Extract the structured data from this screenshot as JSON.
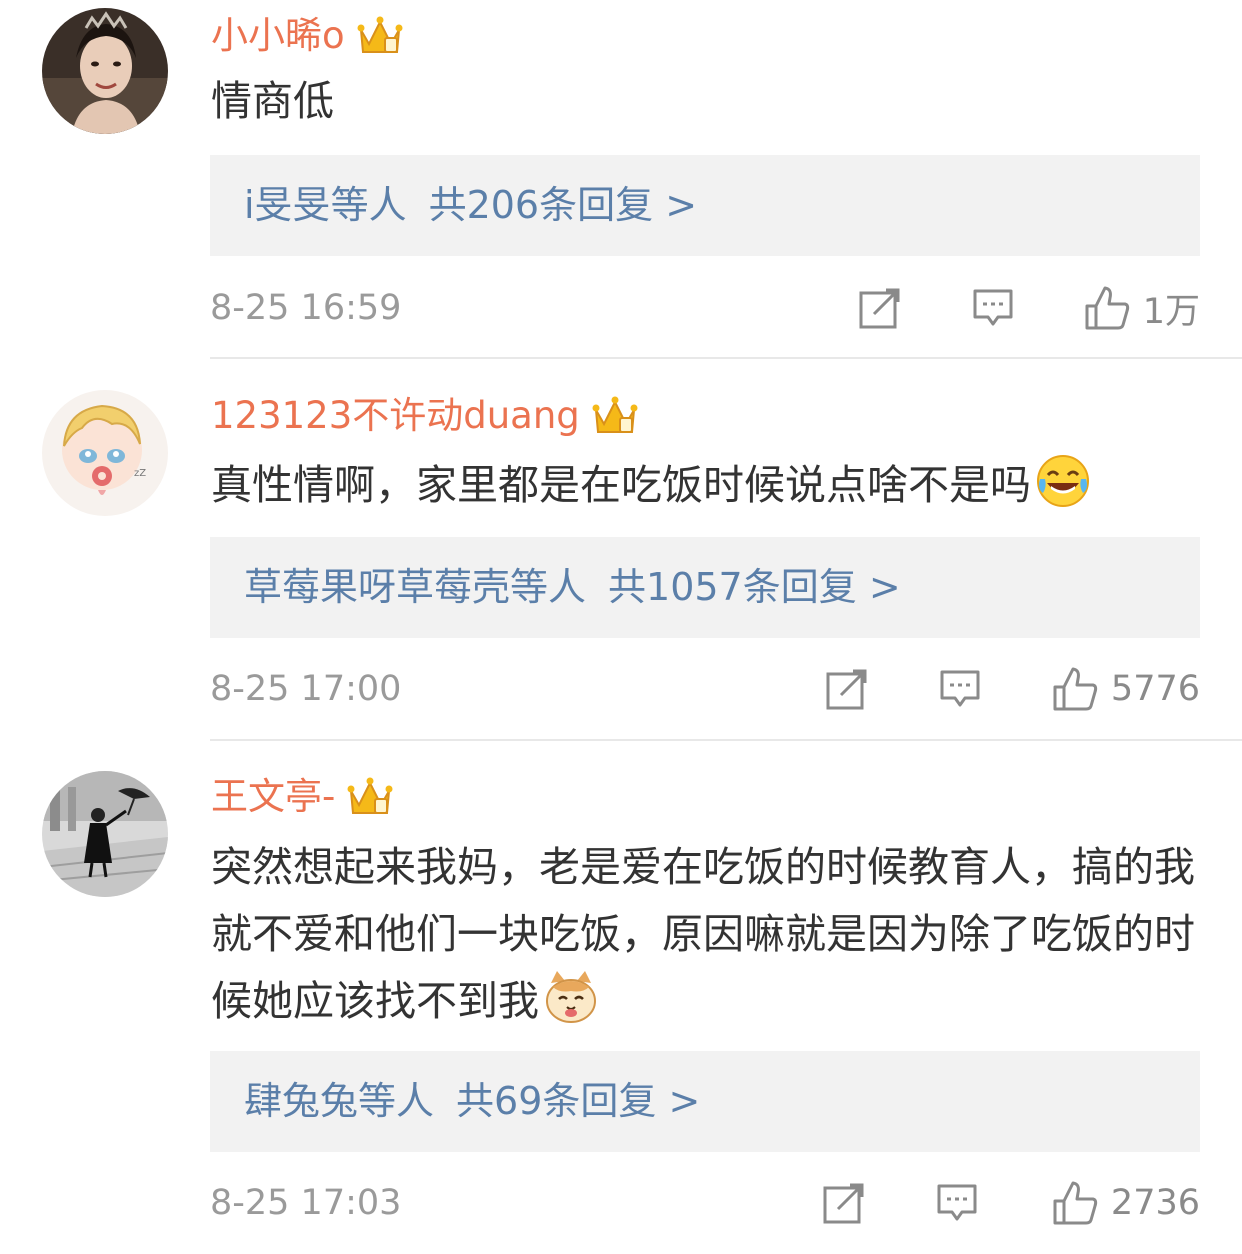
{
  "comments": [
    {
      "username": "小小晞o",
      "text": "情商低",
      "reply_users": "i旻旻",
      "reply_suffix": "等人",
      "reply_count": "共206条回复 >",
      "time": "8-25 16:59",
      "likes": "1万"
    },
    {
      "username": "123123不许动duang",
      "text": "真性情啊，家里都是在吃饭时候说点啥不是吗",
      "emoji": "laugh-cry-emoji",
      "reply_users": "草莓果呀草莓壳",
      "reply_suffix": "等人",
      "reply_count": "共1057条回复 >",
      "time": "8-25 17:00",
      "likes": "5776"
    },
    {
      "username": "王文亭-",
      "text": "突然想起来我妈，老是爱在吃饭的时候教育人，搞的我就不爱和他们一块吃饭，原因嘛就是因为除了吃饭的时候她应该找不到我",
      "emoji": "cat-emoji",
      "reply_users": "肆兔兔",
      "reply_suffix": "等人",
      "reply_count": "共69条回复 >",
      "time": "8-25 17:03",
      "likes": "2736"
    }
  ],
  "colors": {
    "username": "#eb7350",
    "reply_link": "#5b7fa9",
    "reply_bg": "#f2f2f2",
    "meta": "#9a9a9a",
    "text": "#333333"
  },
  "icons": {
    "vip": "crown-icon",
    "repost": "repost-icon",
    "comment": "comment-icon",
    "like": "thumbs-up-icon"
  }
}
